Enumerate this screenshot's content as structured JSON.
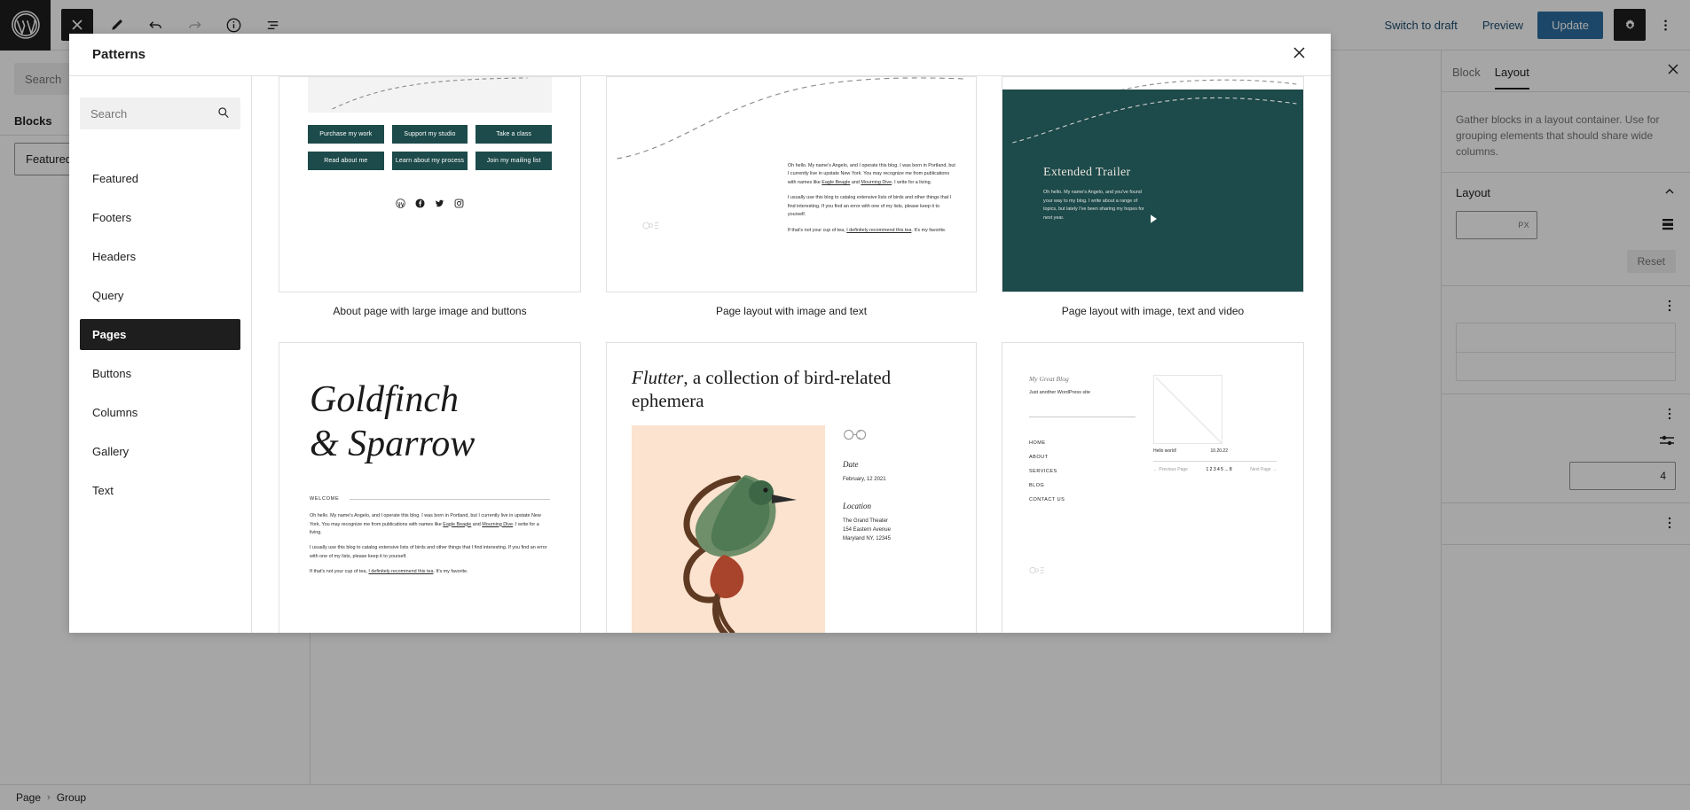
{
  "toolbar": {
    "close_label": "Close",
    "edit_label": "Edit",
    "undo_label": "Undo",
    "redo_label": "Redo",
    "details_label": "Details",
    "list_view_label": "List View",
    "switch_to_draft": "Switch to draft",
    "preview": "Preview",
    "update": "Update",
    "settings_label": "Settings",
    "options_label": "Options",
    "update_bg": "#2b6ea0"
  },
  "left_panel": {
    "search_placeholder": "Search",
    "heading": "Blocks",
    "item": "Featured"
  },
  "right_panel": {
    "tabs": [
      "Block",
      "Layout"
    ],
    "active_tab": "Layout",
    "close_label": "Close settings",
    "description": "Gather blocks in a layout container. Use for grouping elements that should share wide columns.",
    "section_title": "Layout",
    "size_unit": "PX",
    "size_value": "",
    "reset_label": "Reset",
    "number_value": "4"
  },
  "breadcrumb": {
    "items": [
      "Page",
      "Group"
    ],
    "separator": "›"
  },
  "modal": {
    "title": "Patterns",
    "close_label": "Close",
    "search_placeholder": "Search",
    "search_icon": "search-icon",
    "categories": [
      {
        "label": "Featured",
        "active": false
      },
      {
        "label": "Footers",
        "active": false
      },
      {
        "label": "Headers",
        "active": false
      },
      {
        "label": "Query",
        "active": false
      },
      {
        "label": "Pages",
        "active": true
      },
      {
        "label": "Buttons",
        "active": false
      },
      {
        "label": "Columns",
        "active": false
      },
      {
        "label": "Gallery",
        "active": false
      },
      {
        "label": "Text",
        "active": false
      }
    ]
  },
  "patterns": {
    "row1": [
      {
        "caption": "About page with large image and buttons"
      },
      {
        "caption": "Page layout with image and text"
      },
      {
        "caption": "Page layout with image, text and video"
      }
    ],
    "p1": {
      "buttons": [
        "Purchase my work",
        "Support my studio",
        "Take a class",
        "Read about me",
        "Learn about my process",
        "Join my mailing list"
      ],
      "social": [
        "wordpress-icon",
        "facebook-icon",
        "twitter-icon",
        "instagram-icon"
      ],
      "button_color": "#1d4a4a"
    },
    "body_text": {
      "para1_a": "Oh hello. My name's Angelo, and I operate this blog. I was born in Portland, but I currently live in upstate New York. You may recognize me from publications with names like ",
      "para1_link1": "Eagle Beagle",
      "para1_b": " and ",
      "para1_link2": "Mourning Dive",
      "para1_c": ". I write for a living.",
      "para2": "I usually use this blog to catalog extensive lists of birds and other things that I find interesting. If you find an error with one of my lists, please keep it to yourself.",
      "para3_a": "If that's not your cup of tea, ",
      "para3_link": "I definitely recommend this tea",
      "para3_b": ". It's my favorite."
    },
    "p3": {
      "heading": "Extended Trailer",
      "text": "Oh hello. My name's Angelo, and you've found your way to my blog. I write about a range of topics, but lately I've been sharing my hopes for next year.",
      "bg_color": "#1d4a4a",
      "play_icon": "play-icon"
    },
    "p4": {
      "title_line1": "Goldfinch",
      "title_line2": "& Sparrow",
      "welcome_label": "WELCOME"
    },
    "p5": {
      "title_italic": "Flutter",
      "title_rest": ", a collection of bird-related ephemera",
      "binoculars_icon": "binoculars-icon",
      "date_label": "Date",
      "date_value": "February, 12 2021",
      "location_label": "Location",
      "location_line1": "The Grand Theater",
      "location_line2": "154 Eastern Avenue",
      "location_line3": "Maryland NY, 12345",
      "photo_bg": "#fbe3cf"
    },
    "p6": {
      "blog_title": "My Great Blog",
      "tagline": "Just another WordPress site",
      "nav": [
        "HOME",
        "ABOUT",
        "SERVICES",
        "BLOG",
        "CONTACT US"
      ],
      "post_title": "Hello world!",
      "post_date": "10.20.22",
      "prev_label": "←  Previous Page",
      "pages": "1 2 3 4 5 ... 8",
      "next_label": "Next Page  →"
    }
  }
}
